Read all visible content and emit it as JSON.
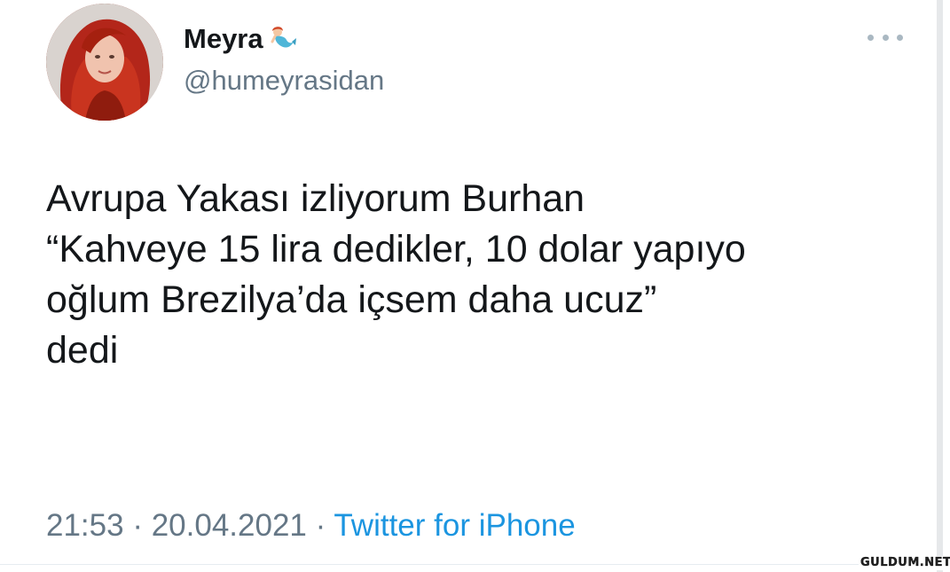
{
  "tweet": {
    "display_name": "Meyra",
    "name_badge_icon": "mermaid-emoji-icon",
    "handle": "@humeyrasidan",
    "text": "Avrupa Yakası izliyorum Burhan\n“Kahveye 15 lira dedikler, 10 dolar yapıyo\noğlum Brezilya’da içsem daha ucuz”\ndedi",
    "time": "21:53",
    "separator": " · ",
    "date": "20.04.2021",
    "source": "Twitter for iPhone",
    "more_icon": "more-dots-icon"
  },
  "watermark": "GULDUM.NET",
  "colors": {
    "text": "#14171a",
    "secondary": "#657786",
    "link": "#1b95e0"
  }
}
